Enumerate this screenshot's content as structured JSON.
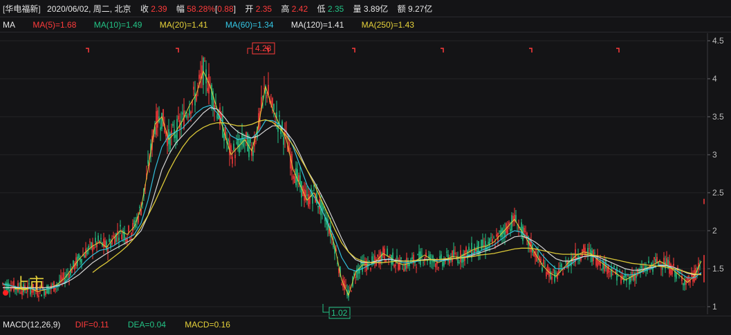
{
  "header": {
    "stock_name": "华电福新",
    "date": "2020/06/02",
    "weekday": "周二",
    "market": "北京",
    "close_label": "收",
    "close_value": "2.39",
    "change_label": "幅",
    "change_value": "58.28%",
    "change_abs": "0.88",
    "open_label": "开",
    "open_value": "2.35",
    "high_label": "高",
    "high_value": "2.42",
    "low_label": "低",
    "low_value": "2.35",
    "volume_label": "量",
    "volume_value": "3.89亿",
    "amount_label": "额",
    "amount_value": "9.27亿"
  },
  "ma_row": {
    "title": "MA",
    "ma5": "MA(5)=1.68",
    "ma10": "MA(10)=1.49",
    "ma20": "MA(20)=1.41",
    "ma60": "MA(60)=1.34",
    "ma120": "MA(120)=1.41",
    "ma250": "MA(250)=1.43"
  },
  "macd_row": {
    "title": "MACD(12,26,9)",
    "dif": "DIF=0.11",
    "dea": "DEA=0.04",
    "macd": "MACD=0.16"
  },
  "annotations": {
    "listing_label": "上市",
    "max_label": "4.28",
    "min_label": "1.02"
  },
  "colors": {
    "up": "#ff3b3b",
    "down": "#23c486",
    "ma5": "#ffffff",
    "ma10": "#e6d23a",
    "ma20": "#e6d23a",
    "ma60": "#34c8e6",
    "ma120": "#ffffff",
    "ma250": "#e6d23a",
    "bg": "#141416"
  },
  "chart_data": {
    "type": "line",
    "y_ticks": [
      "4.5",
      "4",
      "3.5",
      "3",
      "2.5",
      "2",
      "1.5",
      "1"
    ],
    "ylim": [
      0.9,
      4.6
    ],
    "x": [
      0,
      10,
      20,
      30,
      40,
      50,
      60,
      70,
      80,
      90,
      100,
      110,
      120,
      130,
      140,
      150,
      160,
      170,
      180,
      190,
      200,
      210,
      220,
      230,
      240,
      250,
      260,
      270,
      280,
      290,
      300,
      310,
      320,
      330,
      340,
      350,
      360,
      370,
      380,
      390,
      400,
      410,
      420,
      430,
      440,
      450,
      460,
      470,
      480,
      490,
      500,
      510,
      520,
      530,
      540,
      550,
      560,
      570,
      580,
      590,
      600,
      610,
      620,
      630,
      640,
      650,
      660,
      670,
      680,
      690,
      700,
      710,
      720,
      730,
      740,
      750,
      760,
      770,
      780,
      790,
      800,
      810,
      820,
      830,
      840,
      850,
      860,
      870,
      880,
      890,
      900,
      910,
      920,
      930,
      940,
      950,
      960,
      970,
      980,
      990,
      1000,
      1010
    ],
    "series": [
      {
        "key": "price",
        "values": [
          1.3,
          1.28,
          1.25,
          1.22,
          1.24,
          1.2,
          1.22,
          1.25,
          1.3,
          1.38,
          1.5,
          1.62,
          1.72,
          1.8,
          1.85,
          1.78,
          1.9,
          2.0,
          1.95,
          2.05,
          2.3,
          2.8,
          3.4,
          3.5,
          3.2,
          3.3,
          3.45,
          3.65,
          3.8,
          4.1,
          3.9,
          3.6,
          3.3,
          3.0,
          3.1,
          3.2,
          3.05,
          3.4,
          3.9,
          3.6,
          3.4,
          3.2,
          2.8,
          2.6,
          2.4,
          2.5,
          2.3,
          2.1,
          1.8,
          1.35,
          1.15,
          1.45,
          1.55,
          1.55,
          1.6,
          1.7,
          1.65,
          1.58,
          1.55,
          1.58,
          1.62,
          1.68,
          1.62,
          1.58,
          1.62,
          1.66,
          1.65,
          1.7,
          1.75,
          1.78,
          1.8,
          1.85,
          1.95,
          2.05,
          2.15,
          2.0,
          1.85,
          1.7,
          1.55,
          1.45,
          1.4,
          1.5,
          1.6,
          1.68,
          1.72,
          1.7,
          1.62,
          1.55,
          1.48,
          1.42,
          1.35,
          1.4,
          1.45,
          1.5,
          1.55,
          1.6,
          1.55,
          1.48,
          1.4,
          1.32,
          1.4,
          1.6
        ]
      },
      {
        "key": "ma60",
        "values": [
          1.3,
          1.28,
          1.26,
          1.24,
          1.24,
          1.23,
          1.23,
          1.24,
          1.27,
          1.32,
          1.4,
          1.5,
          1.6,
          1.68,
          1.74,
          1.76,
          1.8,
          1.86,
          1.9,
          1.95,
          2.1,
          2.4,
          2.8,
          3.1,
          3.25,
          3.3,
          3.35,
          3.45,
          3.55,
          3.62,
          3.65,
          3.55,
          3.4,
          3.25,
          3.2,
          3.22,
          3.22,
          3.3,
          3.45,
          3.45,
          3.4,
          3.3,
          3.1,
          2.85,
          2.6,
          2.45,
          2.3,
          2.1,
          1.9,
          1.65,
          1.5,
          1.47,
          1.5,
          1.55,
          1.58,
          1.62,
          1.63,
          1.6,
          1.58,
          1.58,
          1.6,
          1.62,
          1.62,
          1.6,
          1.61,
          1.63,
          1.64,
          1.66,
          1.7,
          1.73,
          1.77,
          1.81,
          1.88,
          1.95,
          2.0,
          1.98,
          1.9,
          1.8,
          1.68,
          1.58,
          1.5,
          1.5,
          1.55,
          1.62,
          1.66,
          1.67,
          1.64,
          1.58,
          1.52,
          1.47,
          1.42,
          1.42,
          1.44,
          1.48,
          1.51,
          1.55,
          1.54,
          1.5,
          1.44,
          1.38,
          1.38,
          1.45
        ]
      },
      {
        "key": "ma120",
        "values": [
          1.25,
          1.25,
          1.25,
          1.25,
          1.25,
          1.25,
          1.25,
          1.26,
          1.28,
          1.31,
          1.36,
          1.42,
          1.5,
          1.58,
          1.64,
          1.7,
          1.75,
          1.8,
          1.85,
          1.9,
          2.0,
          2.2,
          2.5,
          2.8,
          3.0,
          3.15,
          3.25,
          3.35,
          3.45,
          3.55,
          3.62,
          3.6,
          3.5,
          3.38,
          3.3,
          3.25,
          3.22,
          3.25,
          3.32,
          3.38,
          3.38,
          3.3,
          3.18,
          3.0,
          2.8,
          2.65,
          2.48,
          2.3,
          2.1,
          1.9,
          1.72,
          1.62,
          1.58,
          1.58,
          1.6,
          1.62,
          1.62,
          1.61,
          1.6,
          1.6,
          1.61,
          1.62,
          1.62,
          1.62,
          1.62,
          1.63,
          1.64,
          1.65,
          1.68,
          1.71,
          1.74,
          1.77,
          1.82,
          1.87,
          1.92,
          1.93,
          1.9,
          1.85,
          1.78,
          1.7,
          1.63,
          1.6,
          1.6,
          1.63,
          1.66,
          1.67,
          1.66,
          1.62,
          1.58,
          1.54,
          1.5,
          1.48,
          1.48,
          1.5,
          1.52,
          1.54,
          1.54,
          1.52,
          1.48,
          1.44,
          1.42,
          1.43
        ]
      },
      {
        "key": "ma250",
        "values": [
          null,
          null,
          null,
          null,
          null,
          null,
          null,
          null,
          null,
          null,
          null,
          null,
          null,
          1.45,
          1.52,
          1.58,
          1.65,
          1.72,
          1.8,
          1.9,
          2.05,
          2.2,
          2.38,
          2.58,
          2.78,
          2.95,
          3.1,
          3.22,
          3.3,
          3.36,
          3.4,
          3.42,
          3.42,
          3.4,
          3.38,
          3.38,
          3.4,
          3.44,
          3.46,
          3.43,
          3.35,
          3.25,
          3.12,
          2.96,
          2.8,
          2.62,
          2.42,
          2.22,
          2.02,
          1.84,
          1.72,
          1.64,
          1.6,
          1.58,
          1.58,
          1.58,
          1.59,
          1.6,
          1.6,
          1.6,
          1.61,
          1.61,
          1.62,
          1.62,
          1.63,
          1.63,
          1.64,
          1.65,
          1.66,
          1.68,
          1.69,
          1.7,
          1.72,
          1.74,
          1.76,
          1.77,
          1.77,
          1.76,
          1.74,
          1.72,
          1.7,
          1.69,
          1.69,
          1.69,
          1.69,
          1.68,
          1.67,
          1.65,
          1.63,
          1.61,
          1.59,
          1.57,
          1.56,
          1.55,
          1.54,
          1.53,
          1.52,
          1.5,
          1.48,
          1.45,
          1.43,
          1.42
        ]
      }
    ]
  }
}
